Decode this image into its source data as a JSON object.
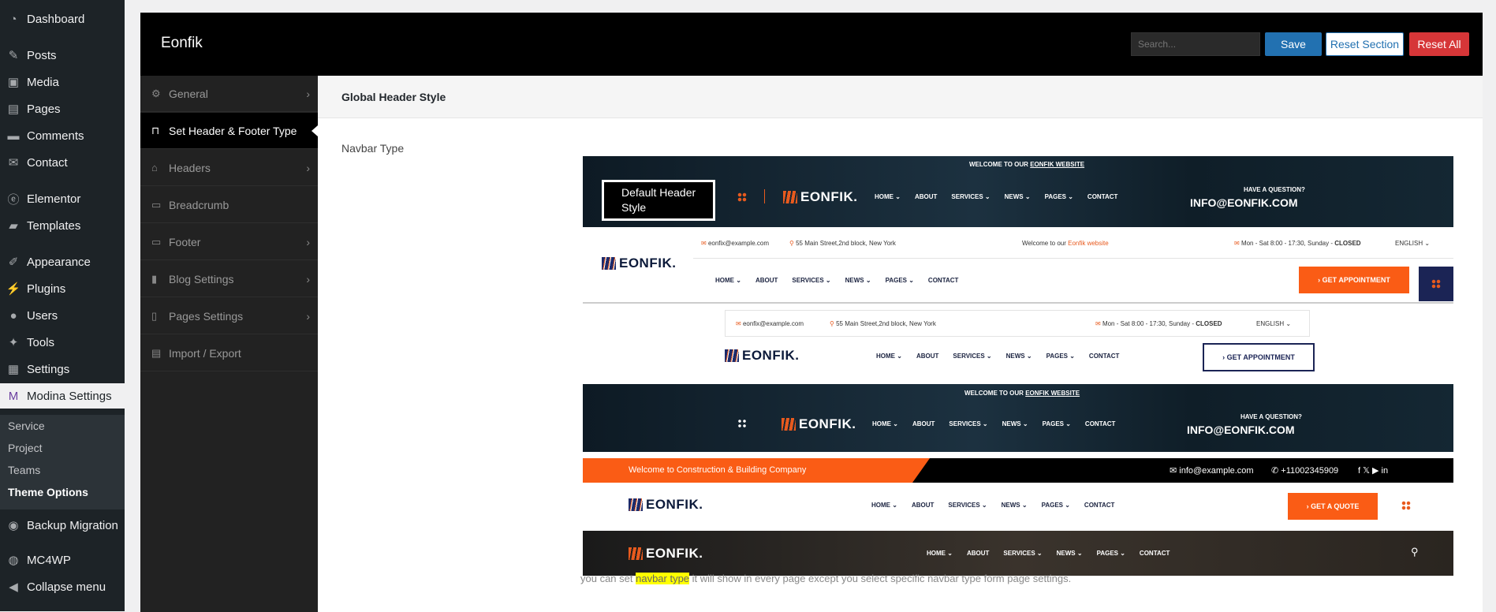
{
  "wp_menu": {
    "items": [
      {
        "label": "Dashboard",
        "icon": "dashboard-icon",
        "glyph": "◔"
      },
      {
        "label": "Posts",
        "icon": "pin-icon",
        "glyph": "✎"
      },
      {
        "label": "Media",
        "icon": "media-icon",
        "glyph": "▣"
      },
      {
        "label": "Pages",
        "icon": "pages-icon",
        "glyph": "▤"
      },
      {
        "label": "Comments",
        "icon": "comments-icon",
        "glyph": "▬"
      },
      {
        "label": "Contact",
        "icon": "mail-icon",
        "glyph": "✉"
      },
      {
        "label": "Elementor",
        "icon": "elementor-icon",
        "glyph": "ⓔ"
      },
      {
        "label": "Templates",
        "icon": "folder-icon",
        "glyph": "▰"
      },
      {
        "label": "Appearance",
        "icon": "brush-icon",
        "glyph": "✐"
      },
      {
        "label": "Plugins",
        "icon": "plugin-icon",
        "glyph": "⚡"
      },
      {
        "label": "Users",
        "icon": "user-icon",
        "glyph": "●"
      },
      {
        "label": "Tools",
        "icon": "wrench-icon",
        "glyph": "✦"
      },
      {
        "label": "Settings",
        "icon": "settings-icon",
        "glyph": "▦"
      },
      {
        "label": "Modina Settings",
        "icon": "modina-icon",
        "glyph": "M"
      },
      {
        "label": "Backup Migration",
        "icon": "backup-icon",
        "glyph": "◉"
      },
      {
        "label": "MC4WP",
        "icon": "mc4wp-icon",
        "glyph": "◍"
      },
      {
        "label": "Collapse menu",
        "icon": "collapse-icon",
        "glyph": "◀"
      }
    ],
    "submenu": [
      "Service",
      "Project",
      "Teams",
      "Theme Options"
    ]
  },
  "panel": {
    "title": "Eonfik",
    "search_placeholder": "Search...",
    "save": "Save",
    "reset_section": "Reset Section",
    "reset_all": "Reset All"
  },
  "tabs": [
    {
      "label": "General",
      "icon": "gears-icon",
      "glyph": "⚙",
      "chevron": "›"
    },
    {
      "label": "Set Header & Footer Type",
      "icon": "car-icon",
      "glyph": "⊓",
      "chevron": ""
    },
    {
      "label": "Headers",
      "icon": "home-icon",
      "glyph": "⌂",
      "chevron": "›"
    },
    {
      "label": "Breadcrumb",
      "icon": "breadcrumb-icon",
      "glyph": "▭",
      "chevron": ""
    },
    {
      "label": "Footer",
      "icon": "footer-icon",
      "glyph": "▭",
      "chevron": "›"
    },
    {
      "label": "Blog Settings",
      "icon": "book-icon",
      "glyph": "▮",
      "chevron": "›"
    },
    {
      "label": "Pages Settings",
      "icon": "pages-settings-icon",
      "glyph": "▯",
      "chevron": "›"
    },
    {
      "label": "Import / Export",
      "icon": "import-export-icon",
      "glyph": "▤",
      "chevron": ""
    }
  ],
  "section": {
    "title": "Global Header Style",
    "field_label": "Navbar Type",
    "desc_before": "you can set ",
    "desc_highlight": "navbar type",
    "desc_after": " it will show in every page except you select specific navbar type form page settings."
  },
  "headers": {
    "brand": "EONFIK.",
    "menu": [
      "HOME ⌄",
      "ABOUT",
      "SERVICES ⌄",
      "NEWS ⌄",
      "PAGES ⌄",
      "CONTACT"
    ],
    "h1": {
      "selected_label": "Default Header Style",
      "welcome_pre": "WELCOME TO OUR ",
      "welcome_link": "EONFIK WEBSITE",
      "question": "HAVE A QUESTION?",
      "email": "INFO@EONFIK.COM"
    },
    "h2": {
      "email": "eonfix@example.com",
      "address": "55 Main Street,2nd block, New York",
      "welcome_pre": "Welcome to our ",
      "welcome_link": "Eonfik website",
      "hours": "Mon - Sat 8:00 - 17:30, Sunday - ",
      "closed": "CLOSED",
      "lang": "ENGLISH ⌄",
      "cta": "› GET APPOINTMENT"
    },
    "h3": {
      "email": "eonfix@example.com",
      "address": "55 Main Street,2nd block, New York",
      "hours": "Mon - Sat 8:00 - 17:30, Sunday - ",
      "closed": "CLOSED",
      "lang": "ENGLISH ⌄",
      "cta": "› GET APPOINTMENT"
    },
    "h4": {
      "welcome_pre": "WELCOME TO OUR ",
      "welcome_link": "EONFIK WEBSITE",
      "question": "HAVE A QUESTION?",
      "email": "INFO@EONFIK.COM"
    },
    "h5": {
      "welcome": "Welcome to Construction & Building Company",
      "email": "✉ info@example.com",
      "phone": "✆ +11002345909",
      "social": "f  𝕏  ▶  in",
      "cta": "› GET A QUOTE"
    },
    "h6": {
      "search_glyph": "⚲"
    }
  }
}
